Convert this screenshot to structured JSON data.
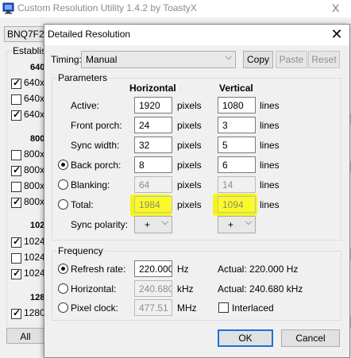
{
  "background_window": {
    "title": "Custom Resolution Utility 1.4.2 by ToastyX",
    "close_glyph": "X",
    "monitor_combo": "BNQ7F2B",
    "group_label": "Establis",
    "sections": [
      {
        "head": "640",
        "items": [
          {
            "label": "640x",
            "checked": true
          },
          {
            "label": "640x",
            "checked": false
          },
          {
            "label": "640x",
            "checked": true
          }
        ]
      },
      {
        "head": "800",
        "items": [
          {
            "label": "800x",
            "checked": false
          },
          {
            "label": "800x",
            "checked": true
          },
          {
            "label": "800x",
            "checked": false
          },
          {
            "label": "800x",
            "checked": true
          }
        ]
      },
      {
        "head": "102",
        "items": [
          {
            "label": "1024",
            "checked": true
          },
          {
            "label": "1024",
            "checked": false
          },
          {
            "label": "1024",
            "checked": true
          }
        ]
      },
      {
        "head": "128",
        "items": [
          {
            "label": "1280",
            "checked": true
          }
        ]
      }
    ],
    "all_button": "All"
  },
  "dialog": {
    "title": "Detailed Resolution",
    "timing": {
      "label": "Timing:",
      "value": "Manual",
      "copy": "Copy",
      "paste": "Paste",
      "reset": "Reset"
    },
    "parameters": {
      "group_label": "Parameters",
      "col_horizontal": "Horizontal",
      "col_vertical": "Vertical",
      "h_unit": "pixels",
      "v_unit": "lines",
      "rows": {
        "active": {
          "label": "Active:",
          "h": "1920",
          "v": "1080"
        },
        "front_porch": {
          "label": "Front porch:",
          "h": "24",
          "v": "3"
        },
        "sync_width": {
          "label": "Sync width:",
          "h": "32",
          "v": "5"
        },
        "back_porch": {
          "label": "Back porch:",
          "h": "8",
          "v": "6"
        },
        "blanking": {
          "label": "Blanking:",
          "h": "64",
          "v": "14"
        },
        "total": {
          "label": "Total:",
          "h": "1984",
          "v": "1094"
        }
      },
      "sync_polarity": {
        "label": "Sync polarity:",
        "h": "+",
        "v": "+"
      }
    },
    "frequency": {
      "group_label": "Frequency",
      "refresh": {
        "label": "Refresh rate:",
        "value": "220.000",
        "unit": "Hz",
        "actual": "Actual: 220.000 Hz"
      },
      "horizontal": {
        "label": "Horizontal:",
        "value": "240.680",
        "unit": "kHz",
        "actual": "Actual: 240.680 kHz"
      },
      "pixel_clock": {
        "label": "Pixel clock:",
        "value": "477.51",
        "unit": "MHz"
      },
      "interlaced": "Interlaced"
    },
    "ok": "OK",
    "cancel": "Cancel"
  },
  "colors": {
    "highlight": "#fafa2a",
    "accent": "#1e6fd9"
  }
}
